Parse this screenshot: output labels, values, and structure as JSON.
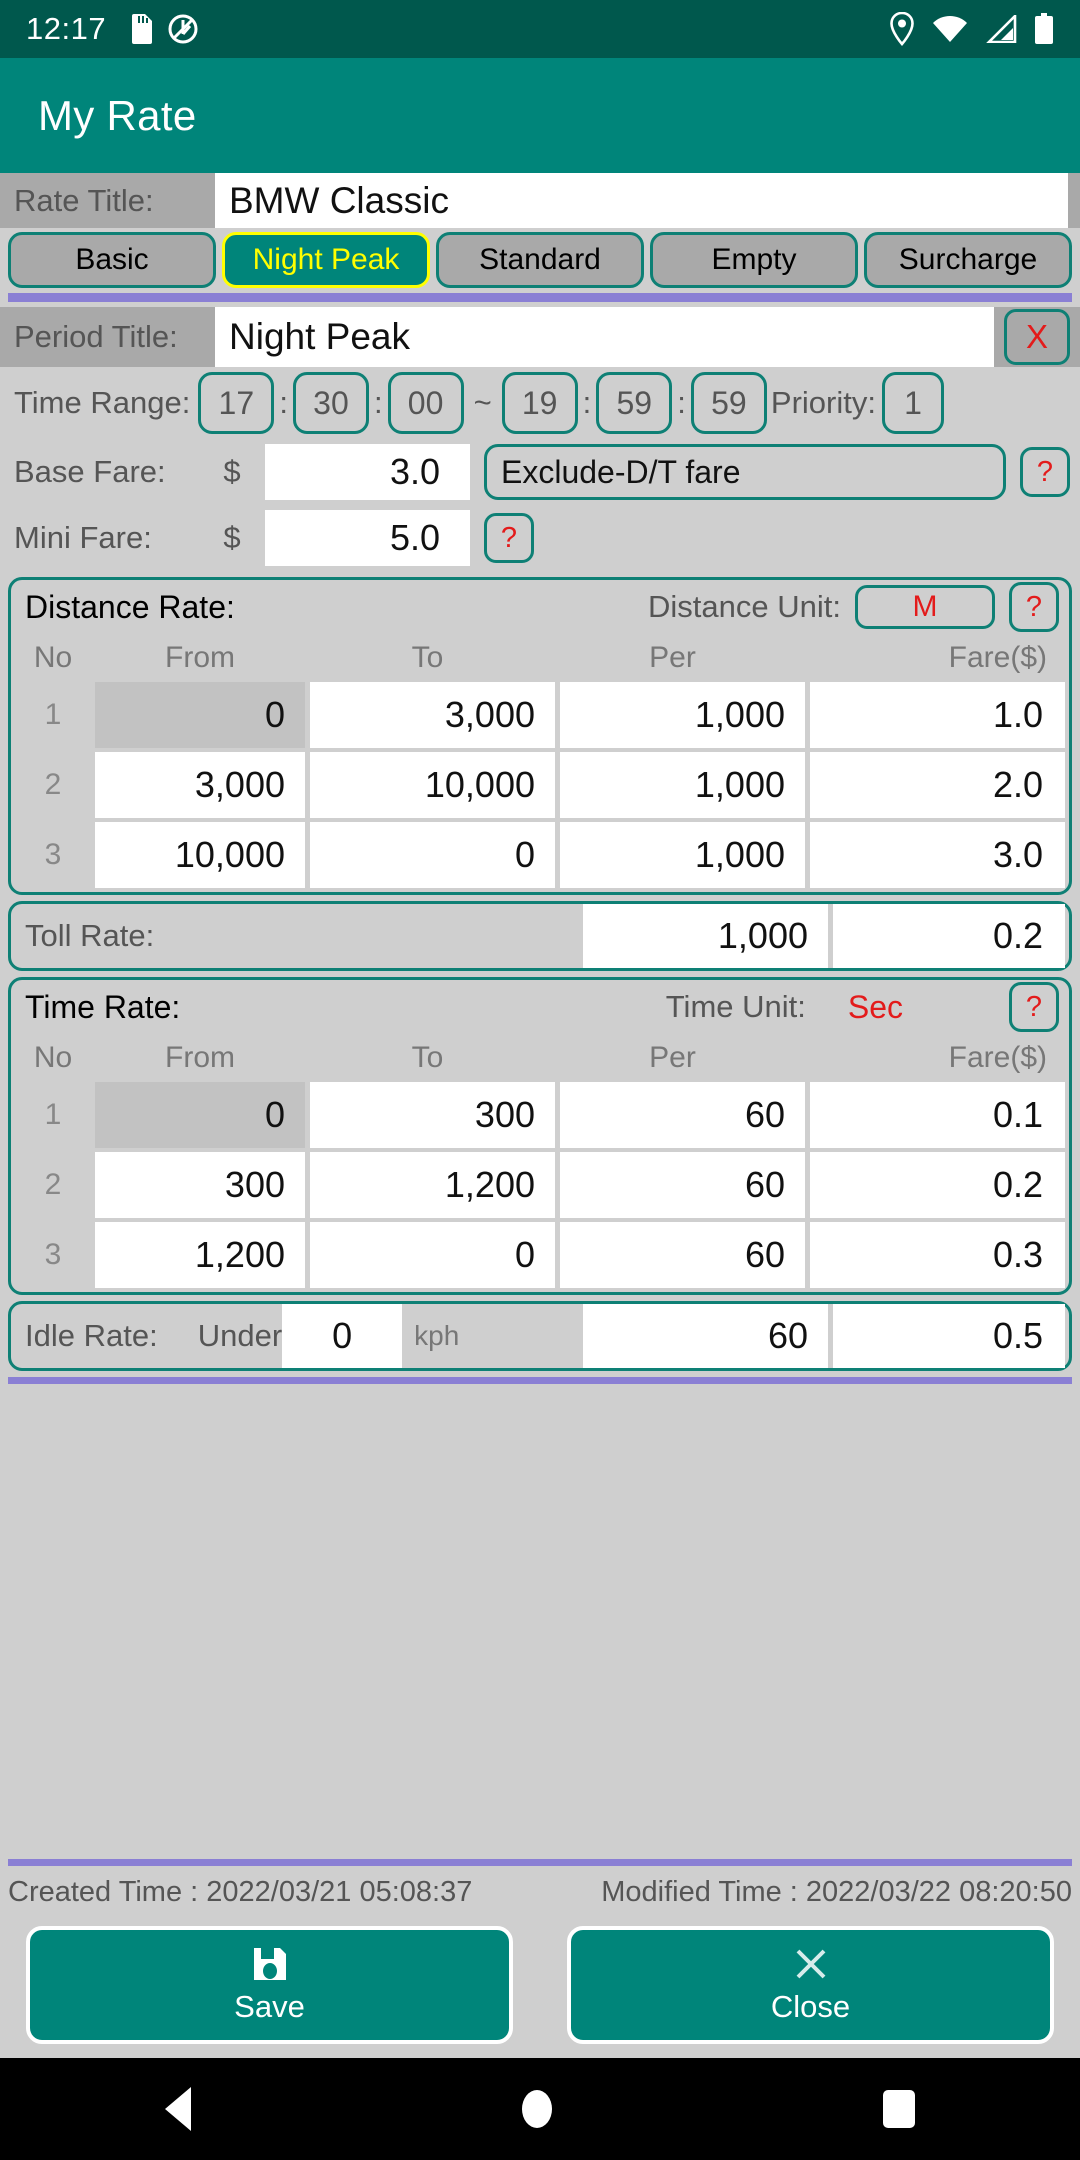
{
  "statusbar": {
    "time": "12:17",
    "left_icons": [
      "sd-card-icon",
      "do-not-disturb-icon"
    ],
    "right_icons": [
      "location-icon",
      "wifi-icon",
      "signal-icon",
      "battery-icon"
    ]
  },
  "appbar": {
    "title": "My Rate"
  },
  "rate_title": {
    "label": "Rate Title:",
    "value": "BMW Classic"
  },
  "tabs": [
    {
      "label": "Basic",
      "active": false
    },
    {
      "label": "Night Peak",
      "active": true
    },
    {
      "label": "Standard",
      "active": false
    },
    {
      "label": "Empty",
      "active": false
    },
    {
      "label": "Surcharge",
      "active": false
    }
  ],
  "period": {
    "label": "Period Title:",
    "value": "Night Peak",
    "delete_label": "X"
  },
  "time_range": {
    "label": "Time Range:",
    "start_hour": "17",
    "start_min": "30",
    "start_sec": "00",
    "separator": "~",
    "end_hour": "19",
    "end_min": "59",
    "end_sec": "59",
    "colon": ":",
    "priority_label": "Priority:",
    "priority_value": "1"
  },
  "base_fare": {
    "label": "Base Fare:",
    "currency": "$",
    "value": "3.0",
    "mode": "Exclude-D/T fare",
    "help": "?"
  },
  "mini_fare": {
    "label": "Mini Fare:",
    "currency": "$",
    "value": "5.0",
    "help": "?"
  },
  "distance_rate": {
    "title": "Distance Rate:",
    "unit_label": "Distance Unit:",
    "unit_value": "M",
    "help": "?",
    "columns": [
      "No",
      "From",
      "To",
      "Per",
      "Fare($)"
    ],
    "rows": [
      {
        "no": "1",
        "from": "0",
        "to": "3,000",
        "per": "1,000",
        "fare": "1.0",
        "from_readonly": true
      },
      {
        "no": "2",
        "from": "3,000",
        "to": "10,000",
        "per": "1,000",
        "fare": "2.0",
        "from_readonly": false
      },
      {
        "no": "3",
        "from": "10,000",
        "to": "0",
        "per": "1,000",
        "fare": "3.0",
        "from_readonly": false
      }
    ]
  },
  "toll_rate": {
    "label": "Toll Rate:",
    "per": "1,000",
    "fare": "0.2"
  },
  "time_rate": {
    "title": "Time Rate:",
    "unit_label": "Time Unit:",
    "unit_value": "Sec",
    "help": "?",
    "columns": [
      "No",
      "From",
      "To",
      "Per",
      "Fare($)"
    ],
    "rows": [
      {
        "no": "1",
        "from": "0",
        "to": "300",
        "per": "60",
        "fare": "0.1",
        "from_readonly": true
      },
      {
        "no": "2",
        "from": "300",
        "to": "1,200",
        "per": "60",
        "fare": "0.2",
        "from_readonly": false
      },
      {
        "no": "3",
        "from": "1,200",
        "to": "0",
        "per": "60",
        "fare": "0.3",
        "from_readonly": false
      }
    ]
  },
  "idle_rate": {
    "label": "Idle Rate:",
    "under_label": "Under",
    "speed": "0",
    "speed_unit": "kph",
    "per": "60",
    "fare": "0.5"
  },
  "footer": {
    "created": "Created Time : 2022/03/21 05:08:37",
    "modified": "Modified Time : 2022/03/22 08:20:50",
    "save_label": "Save",
    "close_label": "Close"
  },
  "navbar": {
    "back": "back-icon",
    "home": "home-icon",
    "recents": "recents-icon"
  },
  "colors": {
    "status_bar": "#00584d",
    "app_bar": "#00857a",
    "accent_border": "#0e8075",
    "page_bg": "#cfcfcf",
    "divider_purple": "#8a7fd4",
    "active_tab_text": "#ffff00",
    "alert_red": "#e31b1b"
  }
}
